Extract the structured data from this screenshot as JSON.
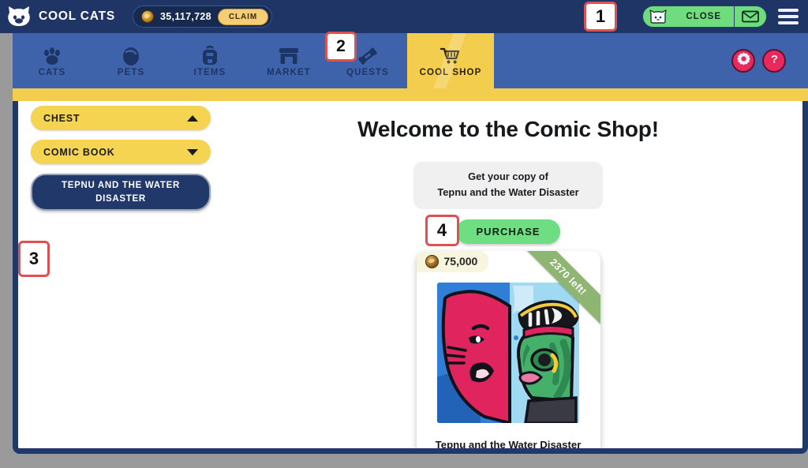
{
  "header": {
    "brand_name": "COOL CATS",
    "logo_icon": "cat-face-icon",
    "currency": {
      "coin_icon": "coin-icon",
      "amount": "35,117,728",
      "claim_label": "CLAIM"
    },
    "close_group": {
      "cat_icon": "cat-face-icon",
      "close_label": "CLOSE",
      "mail_icon": "envelope-icon"
    },
    "menu_icon": "hamburger-menu-icon"
  },
  "nav": {
    "tabs": [
      {
        "label": "CATS",
        "icon": "paw-print-icon",
        "active": false
      },
      {
        "label": "PETS",
        "icon": "egg-icon",
        "active": false
      },
      {
        "label": "ITEMS",
        "icon": "backpack-icon",
        "active": false
      },
      {
        "label": "MARKET",
        "icon": "market-stall-icon",
        "active": false
      },
      {
        "label": "QUESTS",
        "icon": "scroll-icon",
        "active": false
      },
      {
        "label": "COOL SHOP",
        "icon": "shopping-cart-icon",
        "active": true
      }
    ],
    "settings_icon": "gear-icon",
    "help_icon": "question-mark-icon"
  },
  "sidebar": {
    "sections": [
      {
        "label": "CHEST",
        "caret": "chevron-up-icon",
        "expanded": true
      },
      {
        "label": "COMIC BOOK",
        "caret": "chevron-down-icon",
        "expanded": false
      }
    ],
    "selected_item": "TEPNU AND THE WATER DISASTER"
  },
  "shop": {
    "title": "Welcome to the Comic Shop!",
    "info_line_1": "Get your copy of",
    "info_line_2": "Tepnu and the Water Disaster",
    "purchase_label": "PURCHASE",
    "card": {
      "price": "75,000",
      "price_coin_icon": "coin-icon",
      "stock_ribbon": "2370 left!",
      "artwork_alt": "comic-cover-art",
      "title": "Tepnu and the Water Disaster"
    }
  },
  "markers": {
    "m1": "1",
    "m2": "2",
    "m3": "3",
    "m4": "4"
  },
  "colors": {
    "header_blue": "#1e3566",
    "nav_blue": "#3f63ab",
    "accent_yellow": "#f3cd4e",
    "green": "#6fdd82",
    "frame_border": "#21386b",
    "marker_red": "#e05050",
    "pink_red": "#e8295c"
  }
}
